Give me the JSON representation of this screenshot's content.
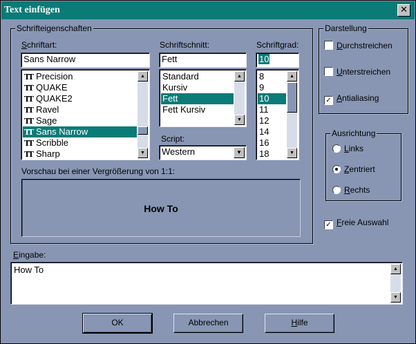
{
  "window": {
    "title": "Text einfügen",
    "close_glyph": "✕"
  },
  "font_props": {
    "legend": "Schrifteigenschaften",
    "font_label_accel": "S",
    "font_label_rest": "chriftart:",
    "style_label": "Schriftschnitt:",
    "size_label": "Schriftgrad:",
    "font_value": "Sans Narrow",
    "style_value": "Fett",
    "size_value": "10",
    "font_icon": "truetype-icon",
    "font_items": [
      "Precision",
      "QUAKE",
      "QUAKE2",
      "Ravel",
      "Sage",
      "Sans Narrow",
      "Scribble",
      "Sharp"
    ],
    "font_selected_index": 5,
    "style_items": [
      "Standard",
      "Kursiv",
      "Fett",
      "Fett Kursiv"
    ],
    "style_selected_index": 2,
    "size_items": [
      "8",
      "9",
      "10",
      "11",
      "12",
      "14",
      "16",
      "18"
    ],
    "size_selected_index": 2,
    "script_label": "Script:",
    "script_value": "Western",
    "preview_label": "Vorschau bei einer Vergrößerung von 1:1:",
    "preview_text": "How To"
  },
  "display": {
    "legend": "Darstellung",
    "strike_accel": "D",
    "strike_rest": "urchstreichen",
    "strike_checked": false,
    "underline_accel": "U",
    "underline_rest": "nterstreichen",
    "underline_checked": false,
    "antialias_accel": "A",
    "antialias_rest": "ntialiasing",
    "antialias_checked": true
  },
  "alignment": {
    "legend": "Ausrichtung",
    "left_accel": "L",
    "left_rest": "inks",
    "center_accel": "Z",
    "center_rest": "entriert",
    "right_accel": "R",
    "right_rest": "echts",
    "selected": "center"
  },
  "free_choice": {
    "accel": "F",
    "rest": "reie Auswahl",
    "checked": true
  },
  "input": {
    "label_accel": "E",
    "label_rest": "ingabe:",
    "value": "How To"
  },
  "buttons": {
    "ok": "OK",
    "cancel": "Abbrechen",
    "help_accel": "H",
    "help_rest": "ilfe"
  },
  "colors": {
    "accent": "#0b7b78",
    "dialog_bg": "#8896b4"
  },
  "glyphs": {
    "check": "✓",
    "up": "▲",
    "down": "▼"
  }
}
